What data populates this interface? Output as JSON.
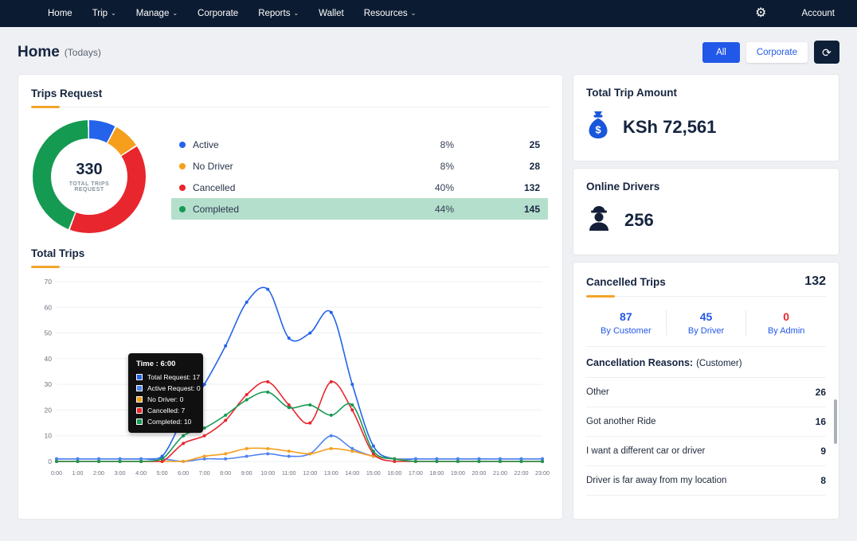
{
  "navbar": {
    "chevron": "⌄",
    "items": [
      {
        "label": "Home"
      },
      {
        "label": "Trip"
      },
      {
        "label": "Manage"
      },
      {
        "label": "Corporate"
      },
      {
        "label": "Reports"
      },
      {
        "label": "Wallet"
      },
      {
        "label": "Resources"
      }
    ],
    "gear_icon": "⚙",
    "account_label": "Account"
  },
  "header": {
    "title": "Home",
    "subtitle": "(Todays)",
    "filter_all": "All",
    "filter_corporate": "Corporate",
    "refresh_icon": "⟳"
  },
  "trips_request": {
    "title": "Trips Request",
    "center_value": "330",
    "center_label": "TOTAL TRIPS REQUEST",
    "legend": [
      {
        "label": "Active",
        "percent": "8%",
        "count": "25",
        "color": "#2563eb"
      },
      {
        "label": "No Driver",
        "percent": "8%",
        "count": "28",
        "color": "#f59f1d"
      },
      {
        "label": "Cancelled",
        "percent": "40%",
        "count": "132",
        "color": "#e8262e"
      },
      {
        "label": "Completed",
        "percent": "44%",
        "count": "145",
        "color": "#159a52"
      }
    ]
  },
  "total_trips": {
    "title": "Total Trips",
    "tooltip": {
      "time": "Time : 6:00",
      "items": [
        {
          "label": "Total Request: 17",
          "color": "#2563eb"
        },
        {
          "label": "Active Request: 0",
          "color": "#4f83f1"
        },
        {
          "label": "No Driver: 0",
          "color": "#f59f1d"
        },
        {
          "label": "Cancelled: 7",
          "color": "#e8262e"
        },
        {
          "label": "Completed: 10",
          "color": "#159a52"
        }
      ]
    }
  },
  "chart_data": [
    {
      "type": "pie",
      "donut": true,
      "title": "Trips Request",
      "labels": [
        "Active",
        "No Driver",
        "Cancelled",
        "Completed"
      ],
      "values": [
        25,
        28,
        132,
        145
      ],
      "percents": [
        8,
        8,
        40,
        44
      ],
      "colors": [
        "#2563eb",
        "#f59f1d",
        "#e8262e",
        "#159a52"
      ],
      "total": 330
    },
    {
      "type": "line",
      "title": "Total Trips",
      "x": [
        "0:00",
        "1:00",
        "2:00",
        "3:00",
        "4:00",
        "5:00",
        "6:00",
        "7:00",
        "8:00",
        "9:00",
        "10:00",
        "11:00",
        "12:00",
        "13:00",
        "14:00",
        "15:00",
        "16:00",
        "17:00",
        "18:00",
        "19:00",
        "20:00",
        "21:00",
        "22:00",
        "23:00"
      ],
      "ylim": [
        0,
        70
      ],
      "ytick_step": 10,
      "grid": true,
      "legend_position": "none",
      "series": [
        {
          "name": "Total Request",
          "color": "#2563eb",
          "values": [
            1,
            1,
            1,
            1,
            1,
            2,
            17,
            30,
            45,
            62,
            67,
            48,
            50,
            58,
            30,
            6,
            1,
            1,
            1,
            1,
            1,
            1,
            1,
            1
          ]
        },
        {
          "name": "Active Request",
          "color": "#4f83f1",
          "values": [
            1,
            1,
            1,
            1,
            1,
            1,
            0,
            1,
            1,
            2,
            3,
            2,
            3,
            10,
            5,
            2,
            1,
            1,
            1,
            1,
            1,
            1,
            1,
            1
          ]
        },
        {
          "name": "No Driver",
          "color": "#f59f1d",
          "values": [
            0,
            0,
            0,
            0,
            0,
            0,
            0,
            2,
            3,
            5,
            5,
            4,
            3,
            5,
            4,
            2,
            1,
            0,
            0,
            0,
            0,
            0,
            0,
            0
          ]
        },
        {
          "name": "Cancelled",
          "color": "#e8262e",
          "values": [
            0,
            0,
            0,
            0,
            0,
            0,
            7,
            10,
            16,
            26,
            31,
            22,
            15,
            31,
            20,
            3,
            0,
            0,
            0,
            0,
            0,
            0,
            0,
            0
          ]
        },
        {
          "name": "Completed",
          "color": "#159a52",
          "values": [
            0,
            0,
            0,
            0,
            0,
            1,
            10,
            13,
            18,
            24,
            27,
            21,
            22,
            18,
            22,
            4,
            1,
            0,
            0,
            0,
            0,
            0,
            0,
            0
          ]
        }
      ]
    }
  ],
  "total_trip_amount": {
    "title": "Total Trip Amount",
    "value": "KSh 72,561",
    "icon_color": "#1a56db"
  },
  "online_drivers": {
    "title": "Online Drivers",
    "value": "256",
    "icon_color": "#141f38"
  },
  "cancelled_trips": {
    "title": "Cancelled Trips",
    "total": "132",
    "stats": [
      {
        "value": "87",
        "label": "By Customer",
        "color": "#2258e8"
      },
      {
        "value": "45",
        "label": "By Driver",
        "color": "#2258e8"
      },
      {
        "value": "0",
        "label": "By Admin",
        "color": "#e8262e"
      }
    ],
    "reasons_title": "Cancellation Reasons:",
    "reasons_subtitle": "(Customer)",
    "reasons": [
      {
        "label": "Other",
        "count": "26"
      },
      {
        "label": "Got another Ride",
        "count": "16"
      },
      {
        "label": "I want a different car or driver",
        "count": "9"
      },
      {
        "label": "Driver is far away from my location",
        "count": "8"
      }
    ]
  }
}
